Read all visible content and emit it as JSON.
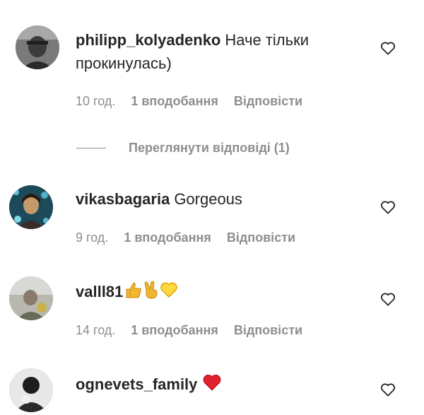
{
  "comments": [
    {
      "username": "philipp_kolyadenko",
      "text": "Наче тільки прокинулась)",
      "time": "10 год.",
      "likes": "1 вподобання",
      "reply": "Відповісти",
      "avatar_color": "#6b6b6b"
    },
    {
      "username": "vikasbagaria",
      "text": "Gorgeous",
      "time": "9 год.",
      "likes": "1 вподобання",
      "reply": "Відповісти",
      "avatar_color": "#2d6f86"
    },
    {
      "username": "valll81",
      "text": "",
      "emojis": [
        "thumbs-up",
        "victory-hand",
        "yellow-heart"
      ],
      "time": "14 год.",
      "likes": "1 вподобання",
      "reply": "Відповісти",
      "avatar_color": "#9a9a8a"
    },
    {
      "username": "ognevets_family",
      "text": "",
      "emojis": [
        "red-heart"
      ],
      "avatar_color": "#3a3a3a"
    }
  ],
  "view_replies": "Переглянути відповіді (1)",
  "colors": {
    "text": "#262626",
    "meta": "#8e8e8e",
    "thumb": "#f2b632",
    "yellow_heart": "#ffd83d",
    "red_heart": "#e0202f"
  }
}
